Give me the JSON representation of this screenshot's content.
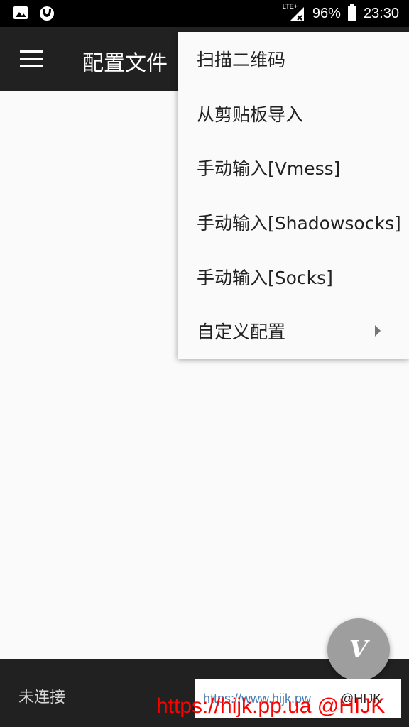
{
  "status_bar": {
    "network": "LTE+",
    "battery": "96%",
    "time": "23:30",
    "icons": [
      "image-icon",
      "face-app-icon",
      "signal-icon",
      "battery-icon"
    ]
  },
  "app_bar": {
    "title": "配置文件",
    "menu_icon": "hamburger-menu-icon"
  },
  "menu": {
    "items": [
      {
        "label": "扫描二维码"
      },
      {
        "label": "从剪贴板导入"
      },
      {
        "label": "手动输入[Vmess]"
      },
      {
        "label": "手动输入[Shadowsocks]"
      },
      {
        "label": "手动输入[Socks]"
      },
      {
        "label": "自定义配置",
        "has_submenu": true
      }
    ]
  },
  "bottom_bar": {
    "status": "未连接"
  },
  "fab": {
    "icon": "v-logo-icon",
    "label": "V"
  },
  "watermark": {
    "url": "https://www.hijk.pw",
    "handle": "@HIJK",
    "red_text": "https://hijk.pp.ua @HIJK"
  },
  "colors": {
    "app_bar": "#212121",
    "fab": "#9e9e9e",
    "watermark_red": "#ff0000"
  }
}
